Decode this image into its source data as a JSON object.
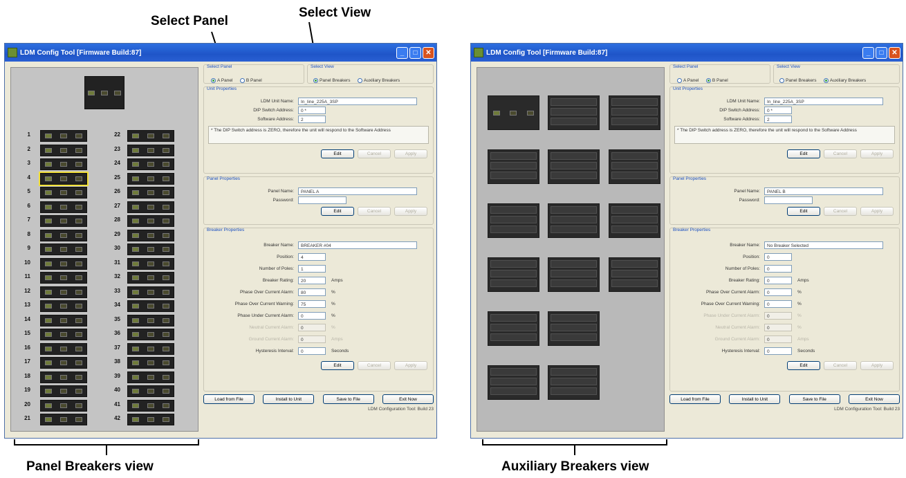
{
  "callouts": {
    "select_panel": "Select Panel",
    "select_view": "Select View",
    "panel_breakers_view": "Panel Breakers view",
    "auxiliary_breakers_view": "Auxiliary Breakers view"
  },
  "windows": [
    {
      "title": "LDM Config Tool [Firmware Build:87]",
      "select_panel": {
        "title": "Select Panel",
        "options": [
          "A Panel",
          "B Panel"
        ],
        "selected": "A Panel"
      },
      "select_view": {
        "title": "Select View",
        "options": [
          "Panel Breakers",
          "Auxiliary Breakers"
        ],
        "selected": "Panel Breakers"
      },
      "unit_properties": {
        "title": "Unit Properties",
        "fields": [
          {
            "label": "LDM Unit Name:",
            "value": "In_line_225A_3SP"
          },
          {
            "label": "DIP Switch Address:",
            "value": "0 *"
          },
          {
            "label": "Software Address:",
            "value": "2"
          }
        ],
        "note": "* The DIP Switch address is ZERO, therefore the unit will respond to the Software Address",
        "buttons": [
          "Edit",
          "Cancel",
          "Apply"
        ]
      },
      "panel_properties": {
        "title": "Panel Properties",
        "fields": [
          {
            "label": "Panel Name:",
            "value": "PANEL A"
          },
          {
            "label": "Password:",
            "value": ""
          }
        ],
        "buttons": [
          "Edit",
          "Cancel",
          "Apply"
        ]
      },
      "breaker_properties": {
        "title": "Breaker Properties",
        "fields": [
          {
            "label": "Breaker Name:",
            "value": "BREAKER #04",
            "unit": "",
            "disabled": false
          },
          {
            "label": "Position:",
            "value": "4",
            "unit": "",
            "disabled": false
          },
          {
            "label": "Number of Poles:",
            "value": "1",
            "unit": "",
            "disabled": false
          },
          {
            "label": "Breaker Rating:",
            "value": "20",
            "unit": "Amps",
            "disabled": false
          },
          {
            "label": "Phase Over Current Alarm:",
            "value": "80",
            "unit": "%",
            "disabled": false
          },
          {
            "label": "Phase Over Current Warning:",
            "value": "75",
            "unit": "%",
            "disabled": false
          },
          {
            "label": "Phase Under Current Alarm:",
            "value": "0",
            "unit": "%",
            "disabled": false
          },
          {
            "label": "Neutral Current Alarm:",
            "value": "0",
            "unit": "%",
            "disabled": true
          },
          {
            "label": "Ground Current Alarm:",
            "value": "0",
            "unit": "Amps",
            "disabled": true
          },
          {
            "label": "Hysteresis Interval:",
            "value": "0",
            "unit": "Seconds",
            "disabled": false
          }
        ],
        "buttons": [
          "Edit",
          "Cancel",
          "Apply"
        ]
      },
      "footer_buttons": [
        "Load from File",
        "Install to Unit",
        "Save to File",
        "Exit Now"
      ],
      "status": "LDM Configuration Tool: Build 23",
      "breaker_numbers_left": [
        "1",
        "2",
        "3",
        "4",
        "5",
        "6",
        "7",
        "8",
        "9",
        "10",
        "11",
        "12",
        "13",
        "14",
        "15",
        "16",
        "17",
        "18",
        "19",
        "20",
        "21"
      ],
      "breaker_numbers_right": [
        "22",
        "23",
        "24",
        "25",
        "26",
        "27",
        "28",
        "29",
        "30",
        "31",
        "32",
        "33",
        "34",
        "35",
        "36",
        "37",
        "38",
        "39",
        "40",
        "41",
        "42"
      ],
      "selected_breaker": "4"
    },
    {
      "title": "LDM Config Tool [Firmware Build:87]",
      "select_panel": {
        "title": "Select Panel",
        "options": [
          "A Panel",
          "B Panel"
        ],
        "selected": "B Panel"
      },
      "select_view": {
        "title": "Select View",
        "options": [
          "Panel Breakers",
          "Auxiliary Breakers"
        ],
        "selected": "Auxiliary Breakers"
      },
      "unit_properties": {
        "title": "Unit Properties",
        "fields": [
          {
            "label": "LDM Unit Name:",
            "value": "In_line_225A_3SP"
          },
          {
            "label": "DIP Switch Address:",
            "value": "0 *"
          },
          {
            "label": "Software Address:",
            "value": "2"
          }
        ],
        "note": "* The DIP Switch address is ZERO, therefore the unit will respond to the Software Address",
        "buttons": [
          "Edit",
          "Cancel",
          "Apply"
        ]
      },
      "panel_properties": {
        "title": "Panel Properties",
        "fields": [
          {
            "label": "Panel Name:",
            "value": "PANEL B"
          },
          {
            "label": "Password:",
            "value": ""
          }
        ],
        "buttons": [
          "Edit",
          "Cancel",
          "Apply"
        ]
      },
      "breaker_properties": {
        "title": "Breaker Properties",
        "fields": [
          {
            "label": "Breaker Name:",
            "value": "No Breaker Selected",
            "unit": "",
            "disabled": false
          },
          {
            "label": "Position:",
            "value": "0",
            "unit": "",
            "disabled": false
          },
          {
            "label": "Number of Poles:",
            "value": "0",
            "unit": "",
            "disabled": false
          },
          {
            "label": "Breaker Rating:",
            "value": "0",
            "unit": "Amps",
            "disabled": false
          },
          {
            "label": "Phase Over Current Alarm:",
            "value": "0",
            "unit": "%",
            "disabled": false
          },
          {
            "label": "Phase Over Current Warning:",
            "value": "0",
            "unit": "%",
            "disabled": false
          },
          {
            "label": "Phase Under Current Alarm:",
            "value": "0",
            "unit": "%",
            "disabled": true
          },
          {
            "label": "Neutral Current Alarm:",
            "value": "0",
            "unit": "%",
            "disabled": true
          },
          {
            "label": "Ground Current Alarm:",
            "value": "0",
            "unit": "Amps",
            "disabled": true
          },
          {
            "label": "Hysteresis Interval:",
            "value": "0",
            "unit": "Seconds",
            "disabled": false
          }
        ],
        "buttons": [
          "Edit",
          "Cancel",
          "Apply"
        ]
      },
      "footer_buttons": [
        "Load from File",
        "Install to Unit",
        "Save to File",
        "Exit Now"
      ],
      "status": "LDM Configuration Tool: Build 23"
    }
  ]
}
